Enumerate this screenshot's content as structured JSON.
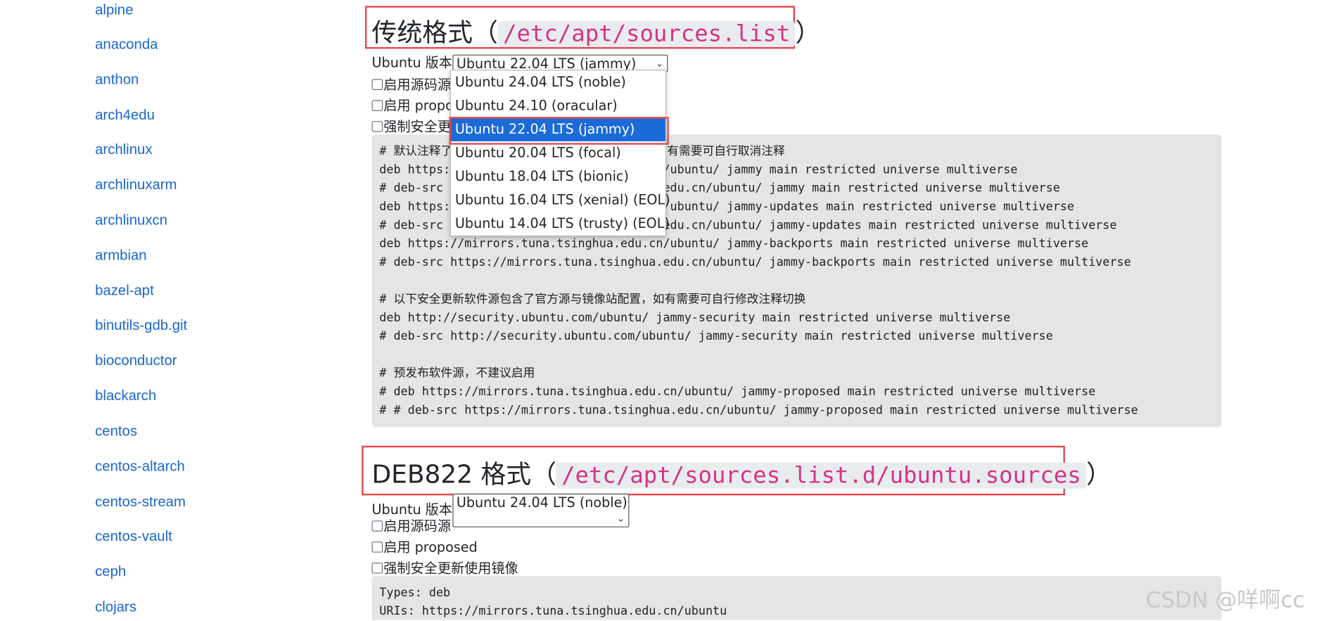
{
  "sidebar": {
    "items": [
      "alpine",
      "anaconda",
      "anthon",
      "arch4edu",
      "archlinux",
      "archlinuxarm",
      "archlinuxcn",
      "armbian",
      "bazel-apt",
      "binutils-gdb.git",
      "bioconductor",
      "blackarch",
      "centos",
      "centos-altarch",
      "centos-stream",
      "centos-vault",
      "ceph",
      "clojars"
    ]
  },
  "section1": {
    "title": "传统格式（",
    "path": "/etc/apt/sources.list",
    "title_end": "）",
    "version_label": "Ubuntu 版本",
    "selected_version": "Ubuntu 22.04 LTS (jammy)",
    "checkboxes": [
      "启用源码源",
      "启用 proposed",
      "强制安全更新使用镜像"
    ],
    "code_lines": [
      "# 默认注释了源码镜像以提高 apt update 速度，如有需要可自行取消注释",
      "deb https://mirrors.tuna.tsinghua.edu.cn/ubuntu/ jammy main restricted universe multiverse",
      "# deb-src https://mirrors.tuna.tsinghua.edu.cn/ubuntu/ jammy main restricted universe multiverse",
      "deb https://mirrors.tuna.tsinghua.edu.cn/ubuntu/ jammy-updates main restricted universe multiverse",
      "# deb-src https://mirrors.tuna.tsinghua.edu.cn/ubuntu/ jammy-updates main restricted universe multiverse",
      "deb https://mirrors.tuna.tsinghua.edu.cn/ubuntu/ jammy-backports main restricted universe multiverse",
      "# deb-src https://mirrors.tuna.tsinghua.edu.cn/ubuntu/ jammy-backports main restricted universe multiverse",
      "",
      "# 以下安全更新软件源包含了官方源与镜像站配置，如有需要可自行修改注释切换",
      "deb http://security.ubuntu.com/ubuntu/ jammy-security main restricted universe multiverse",
      "# deb-src http://security.ubuntu.com/ubuntu/ jammy-security main restricted universe multiverse",
      "",
      "# 预发布软件源，不建议启用",
      "# deb https://mirrors.tuna.tsinghua.edu.cn/ubuntu/ jammy-proposed main restricted universe multiverse",
      "# # deb-src https://mirrors.tuna.tsinghua.edu.cn/ubuntu/ jammy-proposed main restricted universe multiverse"
    ]
  },
  "dropdown": {
    "options": [
      "Ubuntu 24.04 LTS (noble)",
      "Ubuntu 24.10 (oracular)",
      "Ubuntu 22.04 LTS (jammy)",
      "Ubuntu 20.04 LTS (focal)",
      "Ubuntu 18.04 LTS (bionic)",
      "Ubuntu 16.04 LTS (xenial) (EOL)",
      "Ubuntu 14.04 LTS (trusty) (EOL)"
    ],
    "highlighted": "Ubuntu 22.04 LTS (jammy)"
  },
  "section2": {
    "title": "DEB822 格式（",
    "path": "/etc/apt/sources.list.d/ubuntu.sources",
    "title_end": "）",
    "version_label": "Ubuntu 版本",
    "selected_version": "Ubuntu 24.04 LTS (noble)",
    "checkboxes": [
      "启用源码源",
      "启用 proposed",
      "强制安全更新使用镜像"
    ],
    "code_lines": [
      "Types: deb",
      "URIs: https://mirrors.tuna.tsinghua.edu.cn/ubuntu"
    ]
  },
  "watermark": "CSDN @咩啊cc",
  "colors": {
    "link": "#1a66cc",
    "highlight_box": "#e8474b",
    "selected_option": "#1a6ad8",
    "code_bg": "#e5e5e5",
    "code_path": "#d63384"
  }
}
